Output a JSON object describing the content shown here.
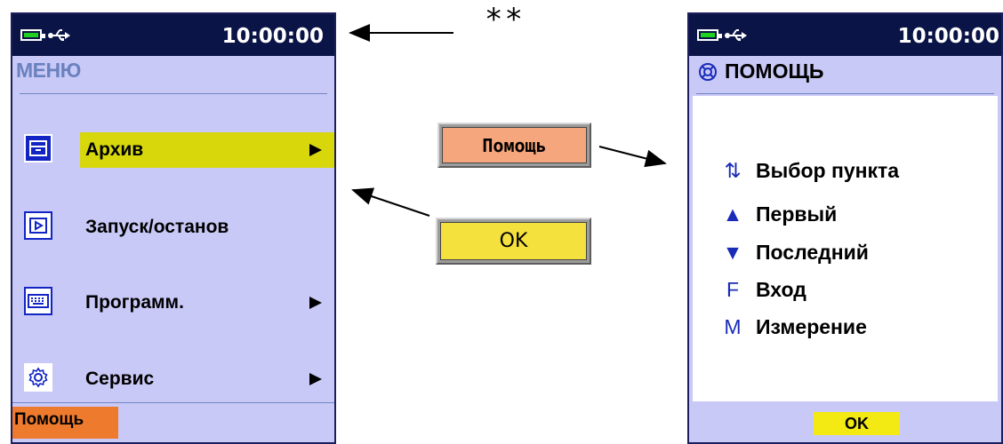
{
  "annotation": "**",
  "left_screen": {
    "status": {
      "time": "10:00:00",
      "usb": "⬖"
    },
    "title": "МЕНЮ",
    "items": [
      {
        "label": "Архив",
        "has_submenu": true,
        "selected": true,
        "icon": "archive-icon"
      },
      {
        "label": "Запуск/останов",
        "has_submenu": false,
        "selected": false,
        "icon": "play-icon"
      },
      {
        "label": "Программ.",
        "has_submenu": true,
        "selected": false,
        "icon": "keyboard-icon"
      },
      {
        "label": "Сервис",
        "has_submenu": true,
        "selected": false,
        "icon": "gear-icon"
      }
    ],
    "softkey_left": "Помощь"
  },
  "buttons": {
    "help": "Помощь",
    "ok": "OK"
  },
  "right_screen": {
    "status": {
      "time": "10:00:00"
    },
    "title": "ПОМОЩЬ",
    "rows": [
      {
        "key": "⇅",
        "label": "Выбор пункта"
      },
      {
        "key": "▲",
        "label": "Первый"
      },
      {
        "key": "▼",
        "label": "Последний"
      },
      {
        "key": "F",
        "label": "Вход"
      },
      {
        "key": "M",
        "label": "Измерение"
      }
    ],
    "softkey_ok": "OK"
  },
  "colors": {
    "screen_bg": "#c9c9f7",
    "status_bg": "#0b1446",
    "selection": "#d7d70c",
    "help_softkey": "#ee7a2e",
    "ok_softkey": "#f2ea12"
  }
}
